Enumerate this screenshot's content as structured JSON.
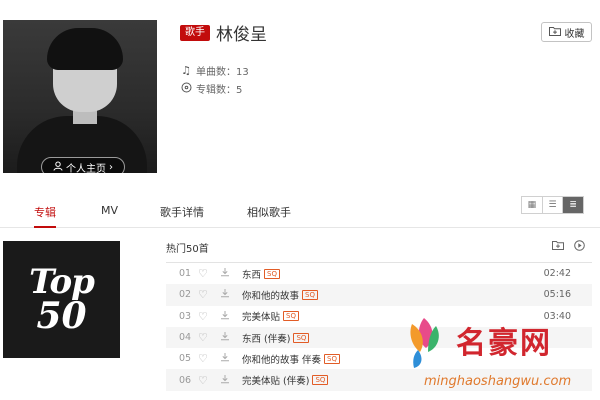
{
  "artist": {
    "badge": "歌手",
    "name": "林俊呈",
    "profile_label": "个人主页",
    "profile_chevron": "›",
    "song_count_label": "单曲数：13",
    "album_count_label": "专辑数：5",
    "favorite_label": "收藏"
  },
  "tabs": [
    {
      "label": "专辑",
      "active": true
    },
    {
      "label": "MV",
      "active": false
    },
    {
      "label": "歌手详情",
      "active": false
    },
    {
      "label": "相似歌手",
      "active": false
    }
  ],
  "view_modes": [
    "grid-icon",
    "list-icon",
    "detail-list-icon"
  ],
  "album": {
    "cover_line1": "Top",
    "cover_line2": "50"
  },
  "tracklist": {
    "title": "热门50首",
    "quality_tag": "SQ",
    "tracks": [
      {
        "no": "01",
        "title": "东西",
        "duration": "02:42"
      },
      {
        "no": "02",
        "title": "你和他的故事",
        "duration": "05:16"
      },
      {
        "no": "03",
        "title": "完美体贴",
        "duration": "03:40"
      },
      {
        "no": "04",
        "title": "东西 (伴奏)",
        "duration": ""
      },
      {
        "no": "05",
        "title": "你和他的故事 伴奏",
        "duration": ""
      },
      {
        "no": "06",
        "title": "完美体贴 (伴奏)",
        "duration": ""
      }
    ]
  },
  "watermark": {
    "name": "名豪网",
    "url": "minghaoshangwu.com"
  },
  "colors": {
    "accent": "#c20c0c",
    "sq_tag": "#e25c26",
    "watermark_red": "#d1262e",
    "watermark_orange": "#e07a2e"
  }
}
